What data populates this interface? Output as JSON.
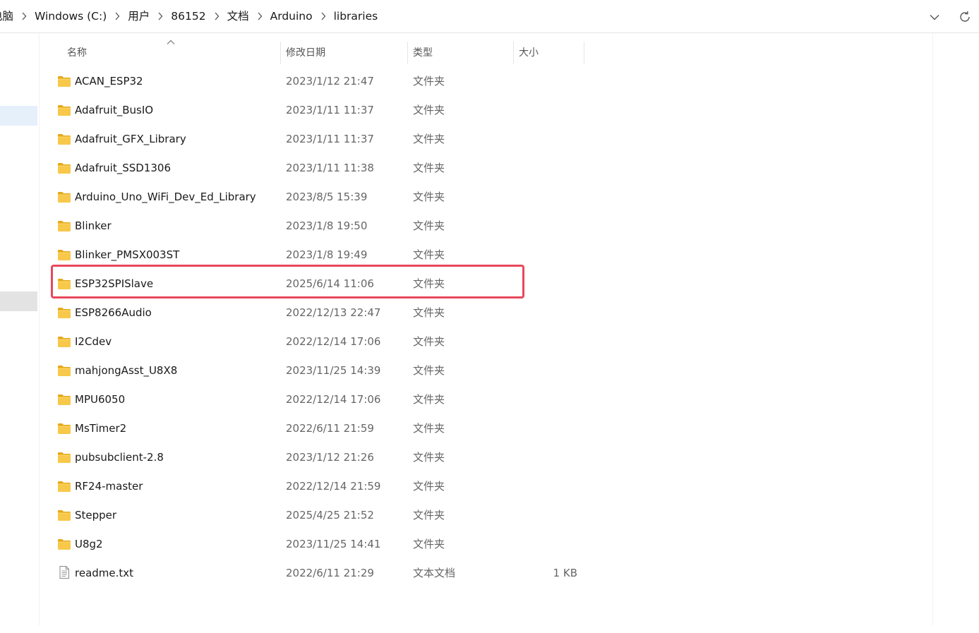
{
  "address_bar": {
    "breadcrumb": [
      "电脑",
      "Windows (C:)",
      "用户",
      "86152",
      "文档",
      "Arduino",
      "libraries"
    ]
  },
  "columns": {
    "name": "名称",
    "date": "修改日期",
    "type": "类型",
    "size": "大小"
  },
  "files": [
    {
      "name": "ACAN_ESP32",
      "date": "2023/1/12 21:47",
      "type": "文件夹",
      "size": "",
      "icon": "folder-icon"
    },
    {
      "name": "Adafruit_BusIO",
      "date": "2023/1/11 11:37",
      "type": "文件夹",
      "size": "",
      "icon": "folder-icon"
    },
    {
      "name": "Adafruit_GFX_Library",
      "date": "2023/1/11 11:37",
      "type": "文件夹",
      "size": "",
      "icon": "folder-icon"
    },
    {
      "name": "Adafruit_SSD1306",
      "date": "2023/1/11 11:38",
      "type": "文件夹",
      "size": "",
      "icon": "folder-icon"
    },
    {
      "name": "Arduino_Uno_WiFi_Dev_Ed_Library",
      "date": "2023/8/5 15:39",
      "type": "文件夹",
      "size": "",
      "icon": "folder-icon"
    },
    {
      "name": "Blinker",
      "date": "2023/1/8 19:50",
      "type": "文件夹",
      "size": "",
      "icon": "folder-icon"
    },
    {
      "name": "Blinker_PMSX003ST",
      "date": "2023/1/8 19:49",
      "type": "文件夹",
      "size": "",
      "icon": "folder-icon"
    },
    {
      "name": "ESP32SPISlave",
      "date": "2025/6/14 11:06",
      "type": "文件夹",
      "size": "",
      "icon": "folder-icon",
      "highlighted": true
    },
    {
      "name": "ESP8266Audio",
      "date": "2022/12/13 22:47",
      "type": "文件夹",
      "size": "",
      "icon": "folder-icon"
    },
    {
      "name": "I2Cdev",
      "date": "2022/12/14 17:06",
      "type": "文件夹",
      "size": "",
      "icon": "folder-icon"
    },
    {
      "name": "mahjongAsst_U8X8",
      "date": "2023/11/25 14:39",
      "type": "文件夹",
      "size": "",
      "icon": "folder-icon"
    },
    {
      "name": "MPU6050",
      "date": "2022/12/14 17:06",
      "type": "文件夹",
      "size": "",
      "icon": "folder-icon"
    },
    {
      "name": "MsTimer2",
      "date": "2022/6/11 21:59",
      "type": "文件夹",
      "size": "",
      "icon": "folder-icon"
    },
    {
      "name": "pubsubclient-2.8",
      "date": "2023/1/12 21:26",
      "type": "文件夹",
      "size": "",
      "icon": "folder-icon"
    },
    {
      "name": "RF24-master",
      "date": "2022/12/14 21:59",
      "type": "文件夹",
      "size": "",
      "icon": "folder-icon"
    },
    {
      "name": "Stepper",
      "date": "2025/4/25 21:52",
      "type": "文件夹",
      "size": "",
      "icon": "folder-icon"
    },
    {
      "name": "U8g2",
      "date": "2023/11/25 14:41",
      "type": "文件夹",
      "size": "",
      "icon": "folder-icon"
    },
    {
      "name": "readme.txt",
      "date": "2022/6/11 21:29",
      "type": "文本文档",
      "size": "1 KB",
      "icon": "text-file-icon"
    }
  ],
  "colors": {
    "folder_yellow": "#f8c84a",
    "folder_dark": "#e6a817",
    "highlight_border": "#e8485c",
    "nav_selected": "#e5f0fb",
    "nav_hover": "#e3e3e3"
  }
}
